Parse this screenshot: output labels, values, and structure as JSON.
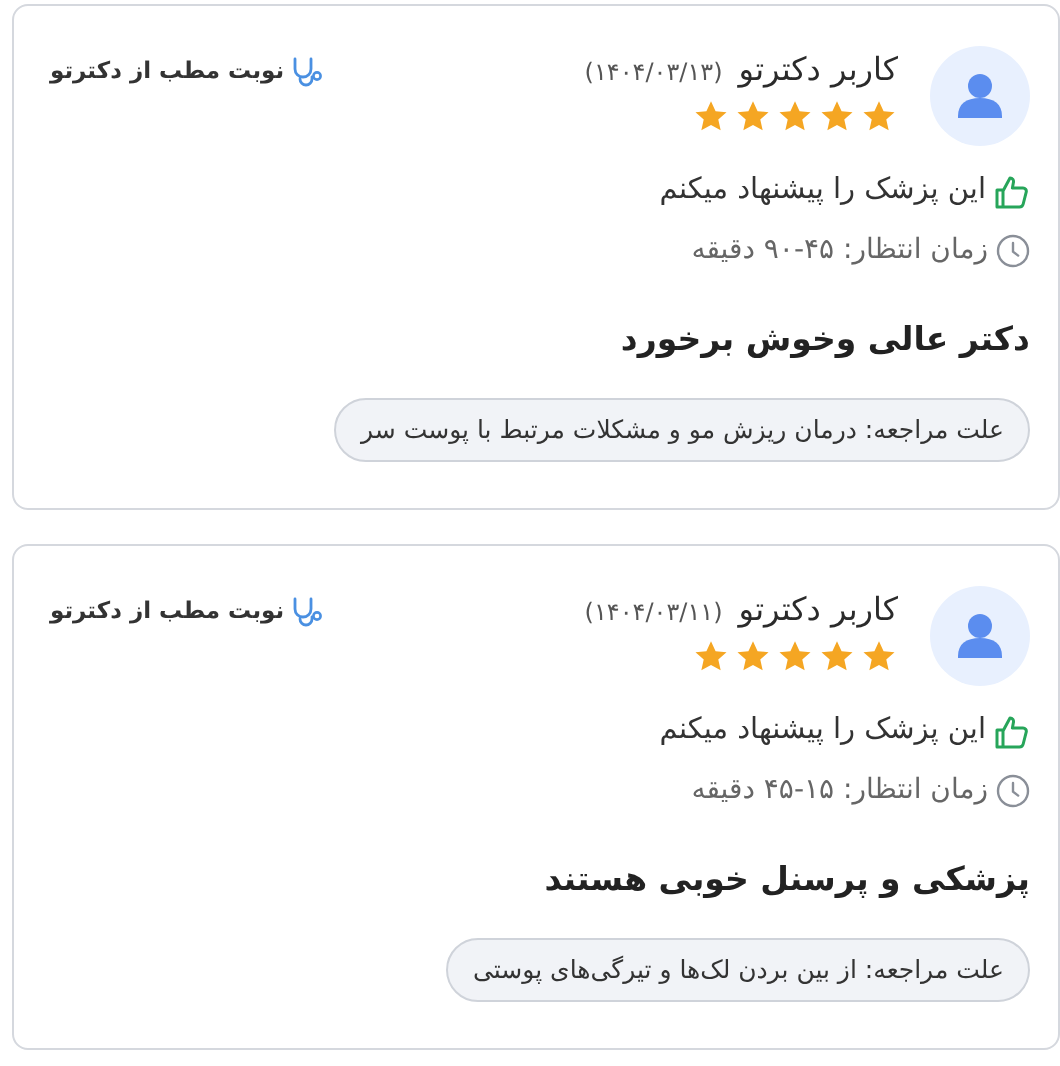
{
  "reviews": [
    {
      "user": "کاربر دکترتو",
      "date": "(۱۴۰۴/۰۳/۱۳)",
      "stars": 5,
      "source": "نوبت مطب از دکترتو",
      "recommend": "این پزشک را پیشنهاد میکنم",
      "wait_time": "زمان انتظار: ۴۵-۹۰ دقیقه",
      "comment": "دکتر عالی وخوش برخورد",
      "reason": "علت مراجعه: درمان ریزش مو و مشکلات مرتبط با پوست سر"
    },
    {
      "user": "کاربر دکترتو",
      "date": "(۱۴۰۴/۰۳/۱۱)",
      "stars": 5,
      "source": "نوبت مطب از دکترتو",
      "recommend": "این پزشک را پیشنهاد میکنم",
      "wait_time": "زمان انتظار: ۱۵-۴۵ دقیقه",
      "comment": "پزشکی و پرسنل خوبی هستند",
      "reason": "علت مراجعه: از بین بردن لک‌ها و تیرگی‌های پوستی"
    }
  ]
}
